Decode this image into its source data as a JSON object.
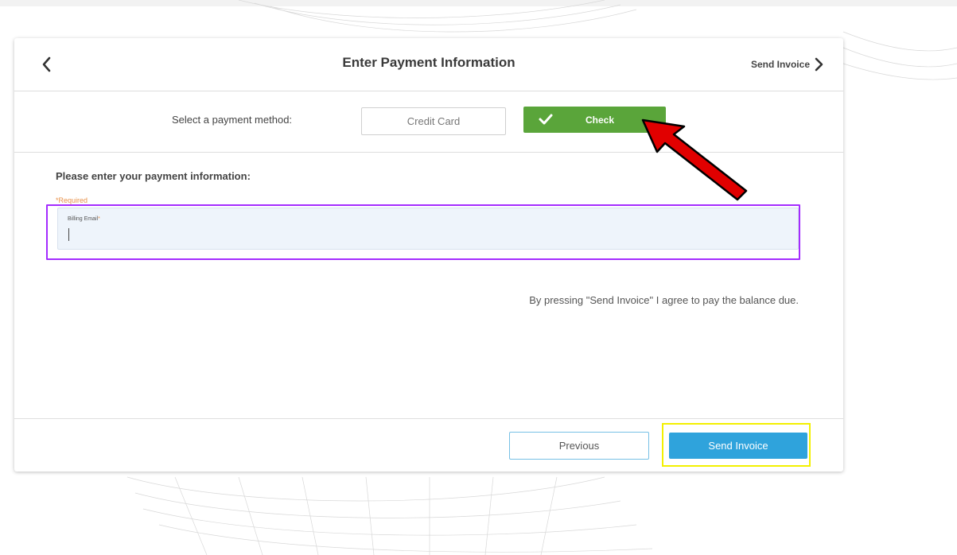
{
  "header": {
    "title": "Enter Payment Information",
    "next_label": "Send Invoice"
  },
  "payment_method": {
    "label": "Select a payment method:",
    "options": [
      {
        "label": "Credit Card",
        "selected": false
      },
      {
        "label": "Check",
        "selected": true
      }
    ]
  },
  "form": {
    "heading": "Please enter your payment information:",
    "required_note": "*Required",
    "billing_email": {
      "label": "Billing Email",
      "required_marker": "*",
      "value": ""
    }
  },
  "agreement_text": "By pressing \"Send Invoice\" I agree to pay the balance due.",
  "footer": {
    "previous_label": "Previous",
    "send_label": "Send Invoice"
  },
  "colors": {
    "check_green": "#5aa53a",
    "send_blue": "#2fa3dc",
    "required_orange": "#e8914a",
    "field_highlight": "#a42cff",
    "button_highlight": "#f3f000",
    "annotation_arrow": "#e10000"
  },
  "icons": {
    "back": "chevron-left-icon",
    "next": "chevron-right-icon",
    "check": "checkmark-icon",
    "annotation": "red-arrow-icon"
  }
}
